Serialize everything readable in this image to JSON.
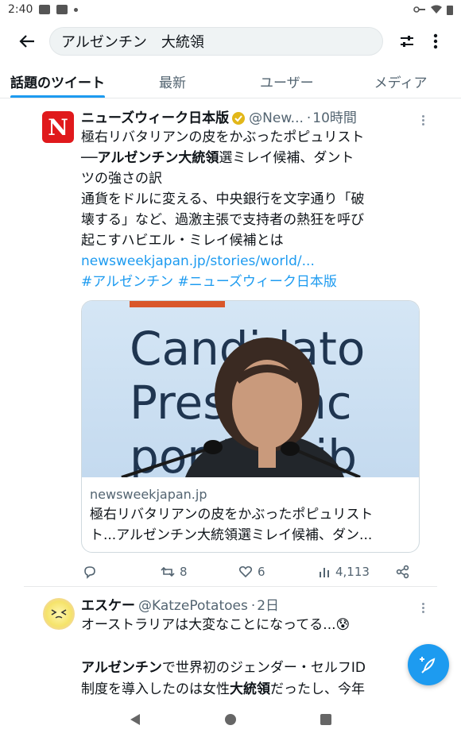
{
  "status_bar": {
    "time": "2:40"
  },
  "search": {
    "query": "アルゼンチン　大統領"
  },
  "tabs": [
    {
      "label": "話題のツイート",
      "active": true
    },
    {
      "label": "最新"
    },
    {
      "label": "ユーザー"
    },
    {
      "label": "メディア"
    }
  ],
  "tweets": [
    {
      "name": "ニューズウィーク日本版",
      "handle": "@New...",
      "time": "10時間",
      "avatar_letter": "N",
      "text_line1": "極右リバタリアンの皮をかぶったポピュリスト",
      "text_line2_prefix": "──",
      "text_line2_bold": "アルゼンチン大統領",
      "text_line2_suffix": "選ミレイ候補、ダント",
      "text_line3": "ツの強さの訳",
      "text_line4": "通貨をドルに変える、中央銀行を文字通り「破",
      "text_line5": "壊する」など、過激主張で支持者の熱狂を呼び",
      "text_line6": "起こすハビエル・ミレイ候補とは",
      "link": "newsweekjapan.jp/stories/world/...",
      "hashtag1": "#アルゼンチン",
      "hashtag2": "#ニューズウィーク日本版",
      "card": {
        "image_text_line1": "Candidato",
        "image_text_line2": "Presidenc",
        "image_text_line3": "por La Lib",
        "domain": "newsweekjapan.jp",
        "title_line1": "極右リバタリアンの皮をかぶったポピュリスト",
        "title_line2": "ト...アルゼンチン大統領選ミレイ候補、ダン..."
      },
      "actions": {
        "retweets": "8",
        "likes": "6",
        "views": "4,113"
      }
    },
    {
      "name": "エスケー",
      "handle": "@KatzePotatoes",
      "time": "2日",
      "text_line1": "オーストラリアは大変なことになってる...😰",
      "text_line3_bold": "アルゼンチン",
      "text_line3_suffix": "で世界初のジェンダー・セルフID",
      "text_line4_prefix": "制度を導入したのは女性",
      "text_line4_bold": "大統領",
      "text_line4_suffix": "だったし、今年"
    }
  ],
  "colors": {
    "accent": "#1d9bf0",
    "brand_red": "#e0191c",
    "verified_gold": "#e2b719"
  }
}
